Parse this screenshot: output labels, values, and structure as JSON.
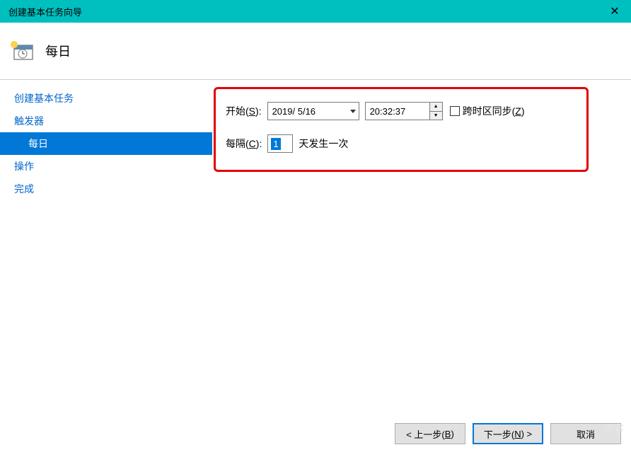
{
  "window": {
    "title": "创建基本任务向导",
    "close": "✕"
  },
  "header": {
    "title": "每日"
  },
  "sidebar": {
    "items": [
      {
        "label": "创建基本任务",
        "sub": false,
        "selected": false
      },
      {
        "label": "触发器",
        "sub": false,
        "selected": false
      },
      {
        "label": "每日",
        "sub": true,
        "selected": true
      },
      {
        "label": "操作",
        "sub": false,
        "selected": false
      },
      {
        "label": "完成",
        "sub": false,
        "selected": false
      }
    ]
  },
  "form": {
    "start_label_prefix": "开始(",
    "start_hotkey": "S",
    "start_label_suffix": "):",
    "date": "2019/ 5/16",
    "time": "20:32:37",
    "sync_label_prefix": "跨时区同步(",
    "sync_hotkey": "Z",
    "sync_label_suffix": ")",
    "interval_label_prefix": "每隔(",
    "interval_hotkey": "C",
    "interval_label_suffix": "):",
    "interval_value": "1",
    "interval_unit": "天发生一次"
  },
  "buttons": {
    "back_prefix": "< 上一步(",
    "back_hotkey": "B",
    "back_suffix": ")",
    "next_prefix": "下一步(",
    "next_hotkey": "N",
    "next_suffix": ") >",
    "cancel": "取消"
  },
  "watermark": "博客"
}
